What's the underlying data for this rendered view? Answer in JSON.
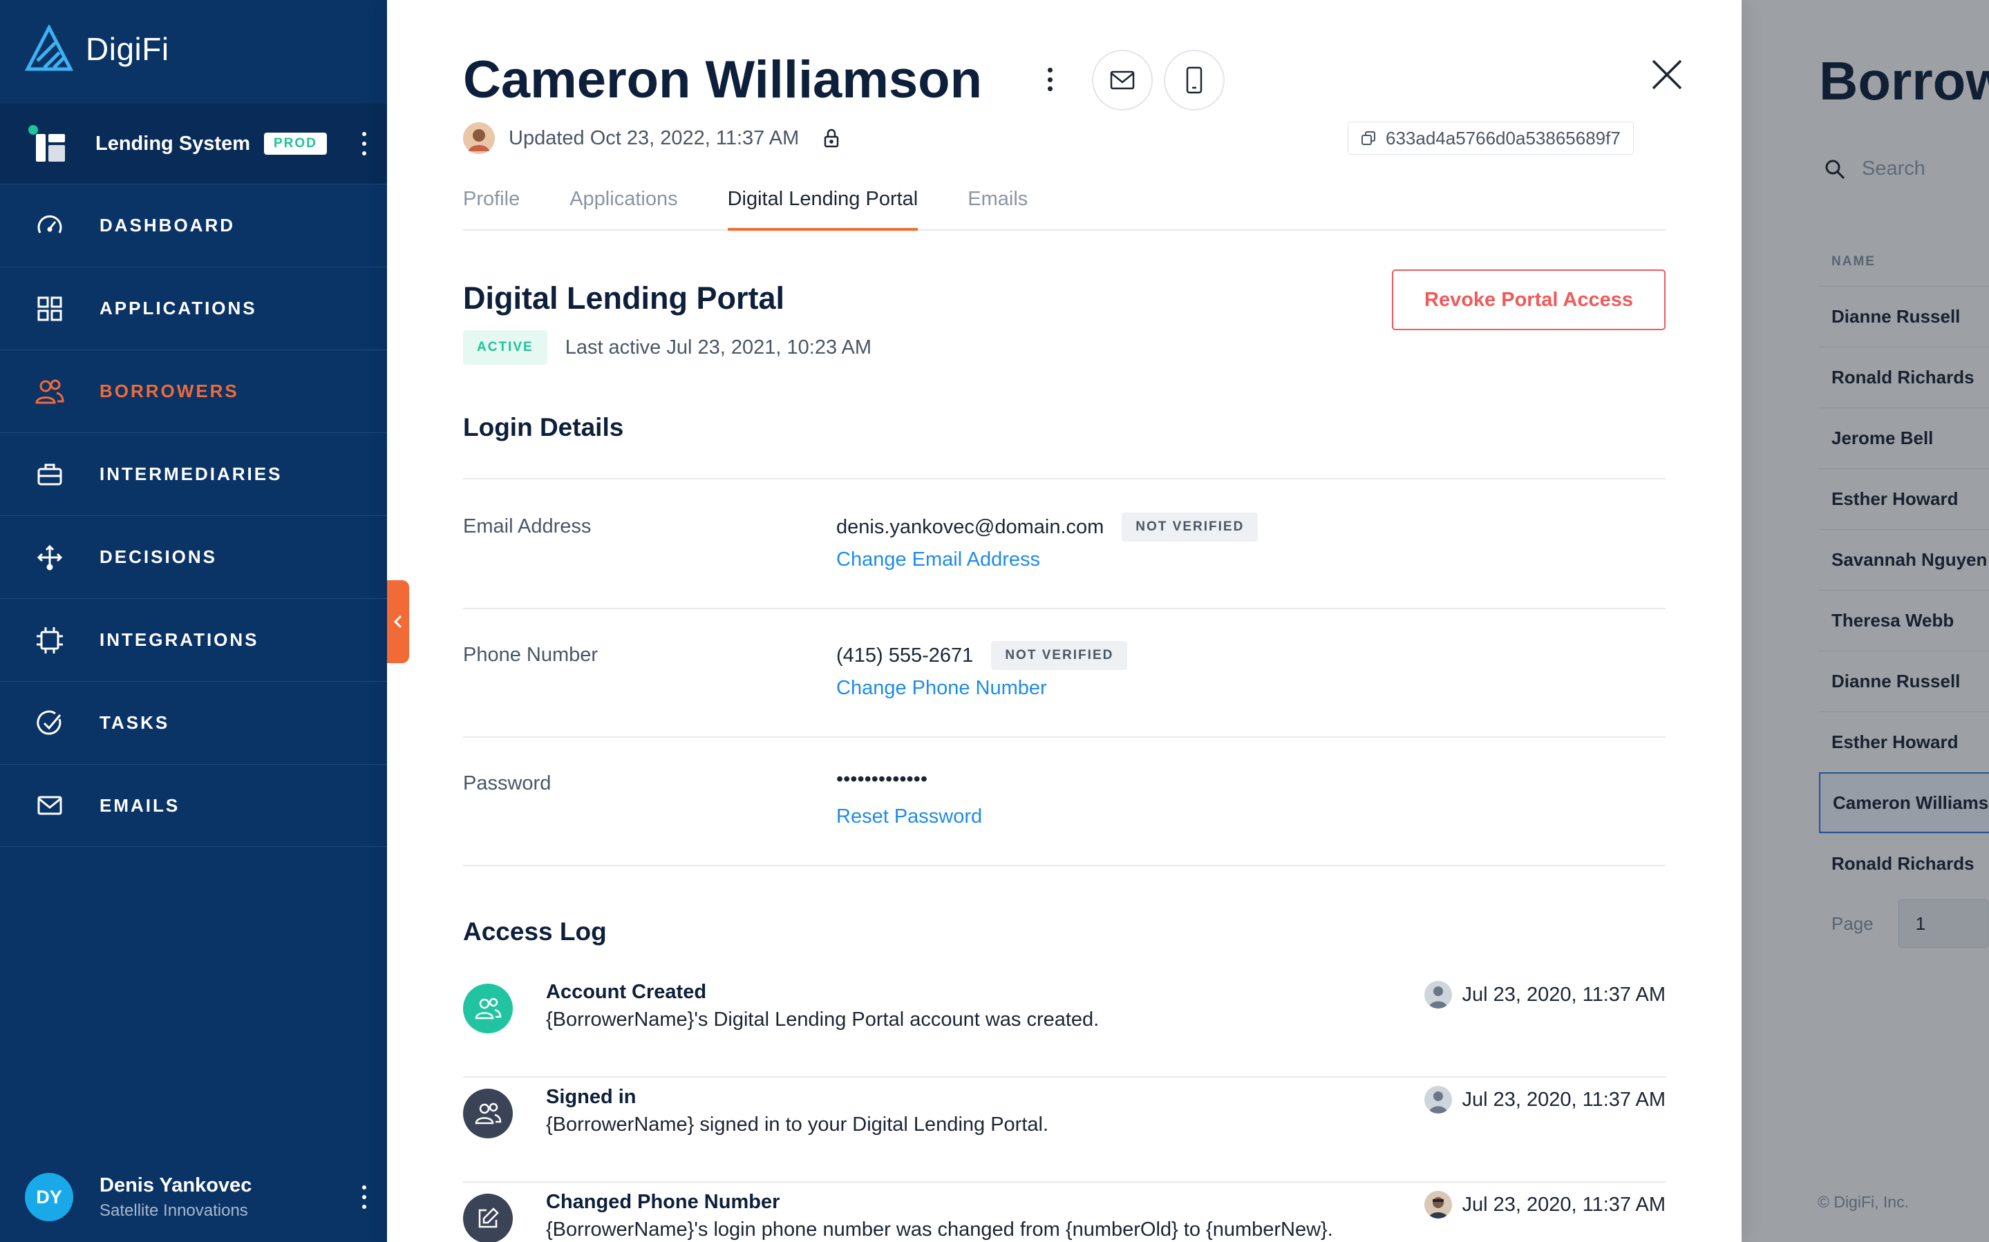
{
  "app": {
    "brand": "DigiFi",
    "system_name": "Lending System",
    "env_badge": "PROD"
  },
  "nav": [
    {
      "key": "dashboard",
      "label": "DASHBOARD",
      "icon": "gauge-icon"
    },
    {
      "key": "applications",
      "label": "APPLICATIONS",
      "icon": "grid-icon"
    },
    {
      "key": "borrowers",
      "label": "BORROWERS",
      "icon": "users-icon",
      "active": true
    },
    {
      "key": "intermediaries",
      "label": "INTERMEDIARIES",
      "icon": "briefcase-icon"
    },
    {
      "key": "decisions",
      "label": "DECISIONS",
      "icon": "arrows-icon"
    },
    {
      "key": "integrations",
      "label": "INTEGRATIONS",
      "icon": "chip-icon"
    },
    {
      "key": "tasks",
      "label": "TASKS",
      "icon": "check-circle-icon"
    },
    {
      "key": "emails",
      "label": "EMAILS",
      "icon": "envelope-icon"
    }
  ],
  "user": {
    "initials": "DY",
    "name": "Denis Yankovec",
    "org": "Satellite Innovations"
  },
  "panel": {
    "title": "Cameron Williamson",
    "updated": "Updated Oct 23, 2022, 11:37 AM",
    "record_id": "633ad4a5766d0a53865689f7",
    "tabs": [
      {
        "label": "Profile"
      },
      {
        "label": "Applications"
      },
      {
        "label": "Digital Lending Portal",
        "active": true
      },
      {
        "label": "Emails"
      }
    ],
    "portal": {
      "title": "Digital Lending Portal",
      "status_badge": "ACTIVE",
      "last_active": "Last active Jul 23, 2021, 10:23 AM",
      "revoke_label": "Revoke Portal Access"
    },
    "login": {
      "title": "Login Details",
      "email": {
        "label": "Email Address",
        "value": "denis.yankovec@domain.com",
        "badge": "NOT VERIFIED",
        "link": "Change Email Address"
      },
      "phone": {
        "label": "Phone Number",
        "value": "(415) 555-2671",
        "badge": "NOT VERIFIED",
        "link": "Change Phone Number"
      },
      "password": {
        "label": "Password",
        "value": "•••••••••••••",
        "link": "Reset Password"
      }
    },
    "access_log": {
      "title": "Access Log",
      "entries": [
        {
          "title": "Account Created",
          "desc": "{BorrowerName}'s Digital Lending Portal account was created.",
          "time": "Jul 23, 2020, 11:37 AM",
          "icon_color": "#20c4a0"
        },
        {
          "title": "Signed in",
          "desc": "{BorrowerName} signed in to your Digital Lending Portal.",
          "time": "Jul 23, 2020, 11:37 AM",
          "icon_color": "#3a4456"
        },
        {
          "title": "Changed Phone Number",
          "desc": "{BorrowerName}'s login phone number was changed from {numberOld} to {numberNew}.",
          "time": "Jul 23, 2020, 11:37 AM",
          "icon_color": "#3a4456"
        }
      ]
    }
  },
  "background": {
    "title": "Borrow",
    "search_placeholder": "Search",
    "column_header": "NAME",
    "rows": [
      "Dianne Russell",
      "Ronald Richards",
      "Jerome Bell",
      "Esther Howard",
      "Savannah Nguyen",
      "Theresa Webb",
      "Dianne Russell",
      "Esther Howard",
      "Cameron Williams",
      "Ronald Richards"
    ],
    "pager_label": "Page",
    "page": "1",
    "footer": "© DigiFi, Inc."
  },
  "colors": {
    "sidebar": "#0a3366",
    "accent": "#f26a35",
    "link": "#1f8be8",
    "danger": "#f05a5a",
    "success": "#1ec39a"
  }
}
